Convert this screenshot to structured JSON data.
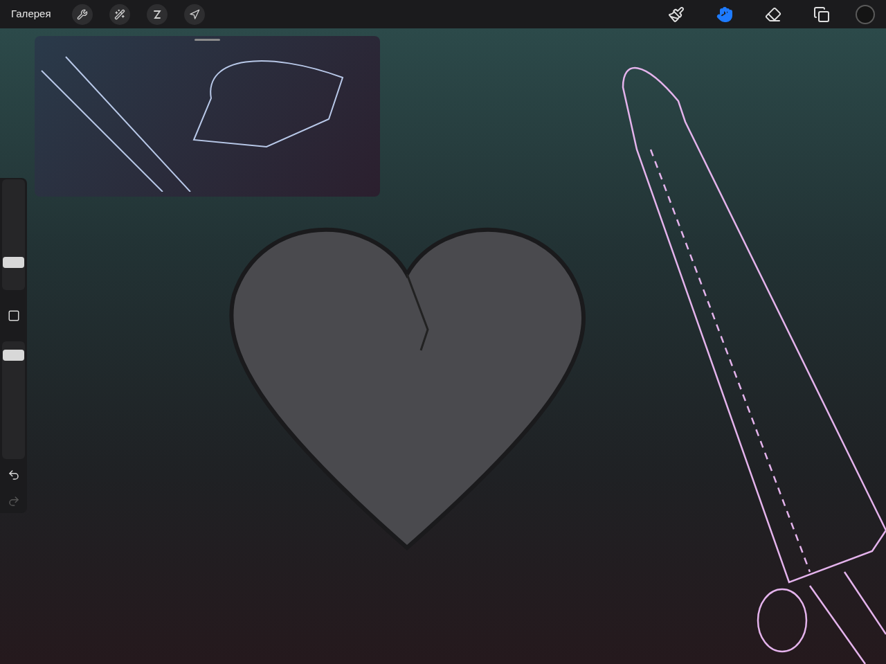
{
  "top_bar": {
    "gallery": "Галерея",
    "actions": [
      {
        "kind": "wrench"
      },
      {
        "kind": "wand"
      },
      {
        "kind": "selection"
      },
      {
        "kind": "transform"
      }
    ]
  },
  "tools": [
    {
      "kind": "brush",
      "selected": false
    },
    {
      "kind": "smudge",
      "selected": true
    },
    {
      "kind": "eraser",
      "selected": false
    },
    {
      "kind": "layers",
      "selected": false
    }
  ],
  "sidebar": {
    "sliders": [
      {
        "level": 0.25
      },
      {
        "level": 0.88
      }
    ],
    "undo": {
      "disabled": false
    },
    "redo": {
      "disabled": true
    }
  }
}
